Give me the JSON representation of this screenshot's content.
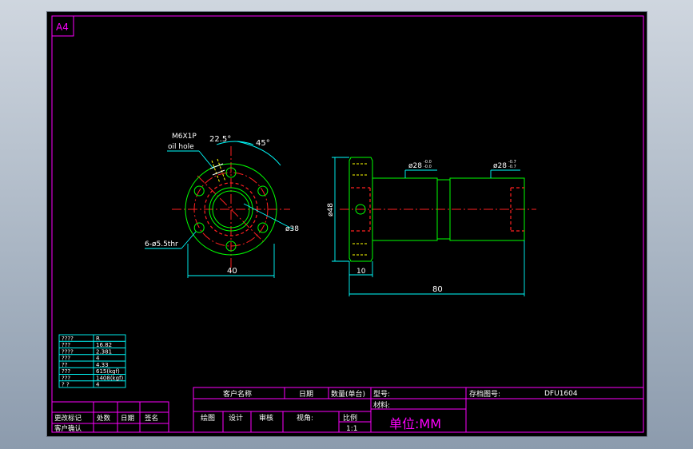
{
  "sheet": {
    "size_label": "A4"
  },
  "annotations": {
    "thread": "M6X1P",
    "oil_hole": "oil hole",
    "angle_small": "22.5°",
    "angle_large": "45°",
    "holes": "6-ø5.5thr",
    "dia_38": "ø38",
    "dim_40": "40",
    "dia_48": "ø48",
    "dim_10": "10",
    "dim_80": "80",
    "dia_28a": "ø28",
    "dia_28a_tol_upper": "-0.0",
    "dia_28a_tol_lower": "-0.0",
    "dia_28b": "ø28",
    "dia_28b_tol_upper": "-0.7",
    "dia_28b_tol_lower": "-0.7"
  },
  "spec_table": {
    "rows": [
      [
        "????",
        "R"
      ],
      [
        "???",
        "16.82"
      ],
      [
        "????",
        "2.381"
      ],
      [
        "???",
        "4"
      ],
      [
        "??",
        "4.33"
      ],
      [
        "???",
        "615(kgf)"
      ],
      [
        "???",
        "1408(kgf)"
      ],
      [
        "? ?",
        "4"
      ]
    ]
  },
  "revision_block": {
    "row1": [
      "更改标记",
      "处数",
      "日期",
      "签名"
    ],
    "row2": [
      "客户确认"
    ]
  },
  "title_block": {
    "customer_name_label": "客户名称",
    "date_label": "日期",
    "quantity_label": "数量(单台)",
    "model_label": "型号:",
    "drawing_no_label": "存档图号:",
    "drawing_no": "DFU1604",
    "material_label": "材料:",
    "drawn_label": "绘图",
    "design_label": "设计",
    "review_label": "审核",
    "view_label": "视角:",
    "scale_label": "比例",
    "scale_value": "1:1",
    "unit_label": "单位:MM"
  },
  "colors": {
    "frame": "#ff00ff",
    "outline": "#00ff00",
    "centerline": "#ff2020",
    "dimension": "#00ffff",
    "text": "#ffffff",
    "hidden": "#ffff00"
  }
}
